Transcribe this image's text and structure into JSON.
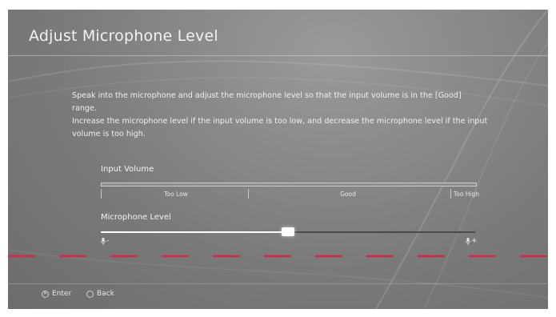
{
  "title": "Adjust Microphone Level",
  "description": {
    "line1": "Speak into the microphone and adjust the microphone level so that the input volume is in the [Good] range.",
    "line2": "Increase the microphone level if the input volume is too low, and decrease the microphone level if the input volume is too high."
  },
  "input_volume": {
    "label": "Input Volume",
    "ranges": [
      "Too Low",
      "Good",
      "Too High"
    ]
  },
  "mic_level": {
    "label": "Microphone Level",
    "value_fraction": 0.5,
    "min_symbol": "-",
    "max_symbol": "+",
    "icon": "microphone-icon"
  },
  "footer": {
    "enter_label": "Enter",
    "enter_icon": "cross-button-icon",
    "back_label": "Back",
    "back_icon": "circle-button-icon"
  },
  "colors": {
    "accent_dash": "#d8264a",
    "text": "#f2f2f2"
  }
}
